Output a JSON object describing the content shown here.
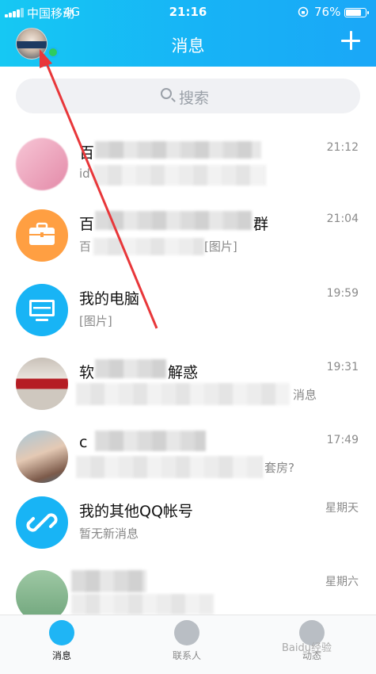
{
  "status_bar": {
    "carrier": "中国移动",
    "network": "4G",
    "time": "21:16",
    "battery": "76%"
  },
  "header": {
    "title": "消息"
  },
  "search": {
    "placeholder": "搜索"
  },
  "conversations": [
    {
      "name_visible": "百",
      "message_visible": "id",
      "time": "21:12"
    },
    {
      "name_visible": "百",
      "name_suffix": "群",
      "message_visible": "百",
      "message_suffix": "[图片]",
      "time": "21:04"
    },
    {
      "name": "我的电脑",
      "message": "[图片]",
      "time": "19:59"
    },
    {
      "name_visible": "软",
      "name_suffix": "解惑",
      "message_suffix": "消息",
      "time": "19:31"
    },
    {
      "name_visible": "c",
      "message_suffix": "套房?",
      "time": "17:49"
    },
    {
      "name": "我的其他QQ帐号",
      "message": "暂无新消息",
      "time": "星期天"
    },
    {
      "name_visible": "",
      "message_visible": "",
      "time": "星期六"
    }
  ],
  "tabs": [
    {
      "label": "消息",
      "active": true
    },
    {
      "label": "联系人",
      "active": false
    },
    {
      "label": "动态",
      "active": false
    }
  ],
  "watermark": "Baidu经验",
  "colors": {
    "header": "#17b3f6",
    "accent": "#18b4f5",
    "orange": "#ff9f42",
    "annotation": "#e8373a"
  }
}
